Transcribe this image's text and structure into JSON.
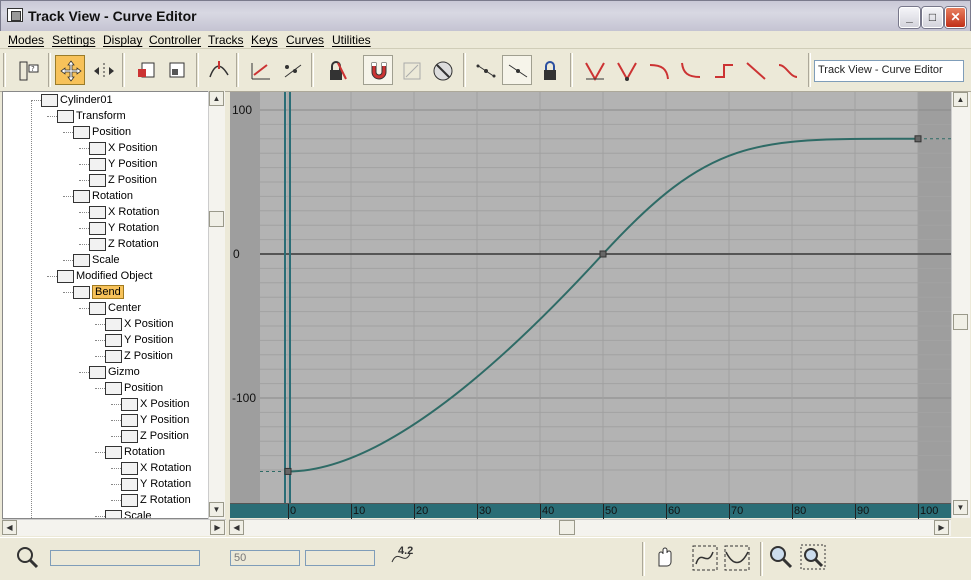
{
  "window": {
    "title": "Track View - Curve Editor",
    "minimize_label": "_",
    "maximize_label": "□",
    "close_label": "✕"
  },
  "menu": [
    "Modes",
    "Settings",
    "Display",
    "Controller",
    "Tracks",
    "Keys",
    "Curves",
    "Utilities"
  ],
  "toolbar": {
    "title_field": "Track View - Curve Editor",
    "icons": [
      "filter-icon",
      "move-keys-icon",
      "slide-keys-icon",
      "scale-keys-icon",
      "scale-values-icon",
      "add-keys-icon",
      "draw-curves-icon",
      "reduce-keys-icon",
      "lock-selection-icon",
      "snap-frames-icon",
      "show-keyable-icon",
      "ignore-animation-range-icon",
      "show-tangents-icon",
      "show-all-tangents-icon",
      "lock-tangents-icon",
      "set-tangents-auto-icon",
      "set-tangents-custom-icon",
      "set-tangents-fast-icon",
      "set-tangents-slow-icon",
      "set-tangents-step-icon",
      "set-tangents-linear-icon",
      "set-tangents-smooth-icon"
    ]
  },
  "tree": [
    {
      "label": "Cylinder01",
      "indent": 0,
      "icon": "cube-icon"
    },
    {
      "label": "Transform",
      "indent": 1,
      "icon": "transform-icon"
    },
    {
      "label": "Position",
      "indent": 2,
      "icon": "position-icon"
    },
    {
      "label": "X Position",
      "indent": 3,
      "icon": "curve-icon"
    },
    {
      "label": "Y Position",
      "indent": 3,
      "icon": "curve-icon"
    },
    {
      "label": "Z Position",
      "indent": 3,
      "icon": "curve-icon"
    },
    {
      "label": "Rotation",
      "indent": 2,
      "icon": "rotation-icon"
    },
    {
      "label": "X Rotation",
      "indent": 3,
      "icon": "curve-icon"
    },
    {
      "label": "Y Rotation",
      "indent": 3,
      "icon": "curve-icon"
    },
    {
      "label": "Z Rotation",
      "indent": 3,
      "icon": "curve-icon"
    },
    {
      "label": "Scale",
      "indent": 2,
      "icon": "scale-icon"
    },
    {
      "label": "Modified Object",
      "indent": 1,
      "icon": "modifier-icon"
    },
    {
      "label": "Bend",
      "indent": 2,
      "icon": "bend-icon",
      "highlight": true
    },
    {
      "label": "Center",
      "indent": 3,
      "icon": "position-icon"
    },
    {
      "label": "X Position",
      "indent": 4,
      "icon": "curve-icon"
    },
    {
      "label": "Y Position",
      "indent": 4,
      "icon": "curve-icon"
    },
    {
      "label": "Z Position",
      "indent": 4,
      "icon": "curve-icon"
    },
    {
      "label": "Gizmo",
      "indent": 3,
      "icon": "transform-icon"
    },
    {
      "label": "Position",
      "indent": 4,
      "icon": "position-icon"
    },
    {
      "label": "X Position",
      "indent": 5,
      "icon": "curve-icon"
    },
    {
      "label": "Y Position",
      "indent": 5,
      "icon": "curve-icon"
    },
    {
      "label": "Z Position",
      "indent": 5,
      "icon": "curve-icon"
    },
    {
      "label": "Rotation",
      "indent": 4,
      "icon": "rotation-icon"
    },
    {
      "label": "X Rotation",
      "indent": 5,
      "icon": "curve-icon"
    },
    {
      "label": "Y Rotation",
      "indent": 5,
      "icon": "curve-icon"
    },
    {
      "label": "Z Rotation",
      "indent": 5,
      "icon": "curve-icon"
    },
    {
      "label": "Scale",
      "indent": 4,
      "icon": "scale-icon"
    }
  ],
  "graph": {
    "y_labels": [
      "100",
      "0",
      "-100"
    ],
    "timeline_labels": [
      "0",
      "10",
      "20",
      "30",
      "40",
      "50",
      "60",
      "70",
      "80",
      "90",
      "100"
    ],
    "curve_color": "#2e6b66",
    "current_frame": 0,
    "keys": [
      {
        "frame": 0,
        "value": -151
      },
      {
        "frame": 50,
        "value": 0
      },
      {
        "frame": 100,
        "value": 80
      }
    ]
  },
  "status": {
    "frame_field": "50",
    "value_field": "",
    "coord_label": "4.2"
  },
  "status_icons": [
    "isolate-curve-icon",
    "pan-icon",
    "zoom-horizontal-extents-icon",
    "zoom-value-extents-icon",
    "zoom-icon",
    "zoom-region-icon"
  ]
}
